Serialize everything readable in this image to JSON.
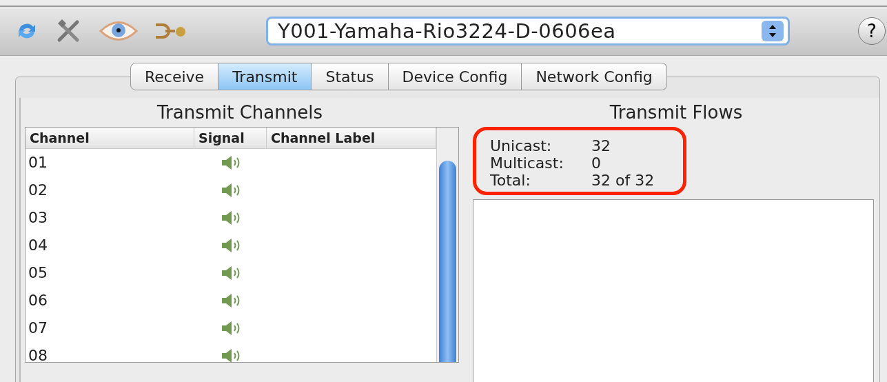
{
  "toolbar": {
    "device": "Y001-Yamaha-Rio3224-D-0606ea",
    "help": "?"
  },
  "tabs": [
    {
      "label": "Receive",
      "selected": false
    },
    {
      "label": "Transmit",
      "selected": true
    },
    {
      "label": "Status",
      "selected": false
    },
    {
      "label": "Device Config",
      "selected": false
    },
    {
      "label": "Network Config",
      "selected": false
    }
  ],
  "channels": {
    "title": "Transmit Channels",
    "columns": [
      "Channel",
      "Signal",
      "Channel Label"
    ],
    "rows": [
      {
        "channel": "01",
        "signal": true
      },
      {
        "channel": "02",
        "signal": true
      },
      {
        "channel": "03",
        "signal": true
      },
      {
        "channel": "04",
        "signal": true
      },
      {
        "channel": "05",
        "signal": true
      },
      {
        "channel": "06",
        "signal": true
      },
      {
        "channel": "07",
        "signal": true
      },
      {
        "channel": "08",
        "signal": true
      }
    ]
  },
  "flows": {
    "title": "Transmit Flows",
    "stats": [
      {
        "label": "Unicast:",
        "value": "32"
      },
      {
        "label": "Multicast:",
        "value": "0"
      },
      {
        "label": "Total:",
        "value": "32 of 32"
      }
    ],
    "highlighted": true
  }
}
